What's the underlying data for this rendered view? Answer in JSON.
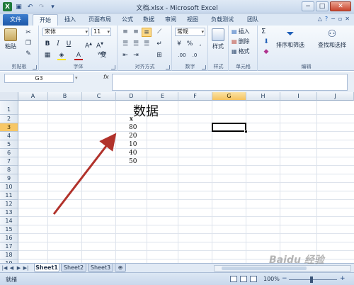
{
  "window": {
    "title": "文档.xlsx - Microsoft Excel",
    "qat_icons": [
      "excel-icon",
      "save-icon",
      "undo-icon",
      "redo-icon",
      "customize-icon"
    ]
  },
  "tabs": [
    {
      "label": "文件",
      "type": "file"
    },
    {
      "label": "开始",
      "type": "active"
    },
    {
      "label": "插入"
    },
    {
      "label": "页面布局"
    },
    {
      "label": "公式"
    },
    {
      "label": "数据"
    },
    {
      "label": "审阅"
    },
    {
      "label": "视图"
    },
    {
      "label": "负载测试"
    },
    {
      "label": "团队"
    }
  ],
  "ribbon": {
    "clipboard": {
      "label": "剪贴板",
      "paste": "粘贴"
    },
    "font": {
      "label": "字体",
      "name": "宋体",
      "size": "11",
      "font_color": "#c00000",
      "fill_color": "#ffe600",
      "wen": "wén"
    },
    "alignment": {
      "label": "对齐方式"
    },
    "number": {
      "label": "数字",
      "format": "常规",
      "percent": "%",
      "comma": ","
    },
    "styles": {
      "label": "样式",
      "button": "样式"
    },
    "cells": {
      "label": "单元格",
      "insert": "插入",
      "delete": "删除",
      "format": "格式"
    },
    "editing": {
      "label": "编辑",
      "sum": "Σ",
      "sort": "排序和筛选",
      "find": "查找和选择"
    }
  },
  "formula_bar": {
    "name_box": "G3",
    "fx": "fx",
    "value": ""
  },
  "grid": {
    "columns": [
      "A",
      "B",
      "C",
      "D",
      "E",
      "F",
      "G",
      "H",
      "I",
      "J"
    ],
    "selected_column": "G",
    "rows": [
      "1",
      "2",
      "3",
      "4",
      "5",
      "6",
      "7",
      "8",
      "9",
      "10",
      "11",
      "12",
      "13",
      "14",
      "15",
      "16",
      "17",
      "18",
      "19"
    ],
    "selected_row": "3",
    "title_cell": "数据",
    "header_cell": "x",
    "values": [
      "80",
      "20",
      "10",
      "40",
      "50"
    ]
  },
  "sheets": [
    {
      "name": "Sheet1",
      "active": true
    },
    {
      "name": "Sheet2",
      "active": false
    },
    {
      "name": "Sheet3",
      "active": false
    }
  ],
  "status": {
    "ready": "就绪",
    "zoom": "100%",
    "minus": "−",
    "plus": "+"
  },
  "watermark": "Baidu 经验",
  "colors": {
    "arrow": "#b1322b",
    "selection": "#000000",
    "file_tab": "#1c57a8"
  }
}
